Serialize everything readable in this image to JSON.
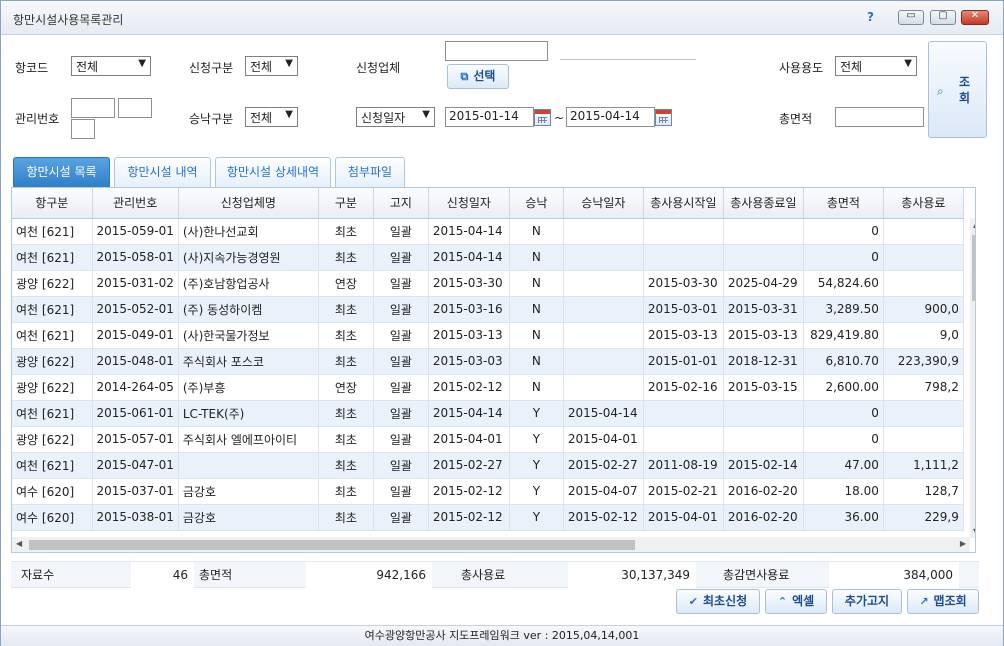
{
  "window": {
    "title": "항만시설사용목록관리",
    "help": "?",
    "min": "▭",
    "max": "▢",
    "close": "✕"
  },
  "filters": {
    "port_code": {
      "label": "항코드",
      "value": "전체"
    },
    "apply_type": {
      "label": "신청구분",
      "value": "전체"
    },
    "applicant": {
      "label": "신청업체",
      "value": "",
      "select_label": "선택"
    },
    "usage": {
      "label": "사용용도",
      "value": "전체"
    },
    "mgmt_no": {
      "label": "관리번호",
      "v1": "",
      "v2": "",
      "v3": ""
    },
    "approve_type": {
      "label": "승낙구분",
      "value": "전체"
    },
    "date_type": {
      "value": "신청일자"
    },
    "date_from": "2015-01-14",
    "date_sep": "~",
    "date_to": "2015-04-14",
    "total_area": {
      "label": "총면적",
      "value": ""
    },
    "search_label": "조회"
  },
  "tabs": [
    {
      "label": "항만시설 목록",
      "active": true
    },
    {
      "label": "항만시설 내역",
      "active": false
    },
    {
      "label": "항만시설 상세내역",
      "active": false
    },
    {
      "label": "첨부파일",
      "active": false
    }
  ],
  "table": {
    "headers": [
      "항구분",
      "관리번호",
      "신청업체명",
      "구분",
      "고지",
      "신청일자",
      "승낙",
      "승낙일자",
      "총사용시작일",
      "총사용종료일",
      "총면적",
      "총사용료"
    ],
    "rows": [
      [
        "여천 [621]",
        "2015-059-01",
        "(사)한나선교회",
        "최초",
        "일괄",
        "2015-04-14",
        "N",
        "",
        "",
        "",
        "0",
        ""
      ],
      [
        "여천 [621]",
        "2015-058-01",
        "(사)지속가능경영원",
        "최초",
        "일괄",
        "2015-04-14",
        "N",
        "",
        "",
        "",
        "0",
        ""
      ],
      [
        "광양 [622]",
        "2015-031-02",
        "(주)호남항업공사",
        "연장",
        "일괄",
        "2015-03-30",
        "N",
        "",
        "2015-03-30",
        "2025-04-29",
        "54,824.60",
        ""
      ],
      [
        "여천 [621]",
        "2015-052-01",
        "(주) 동성하이켐",
        "최초",
        "일괄",
        "2015-03-16",
        "N",
        "",
        "2015-03-01",
        "2015-03-31",
        "3,289.50",
        "900,0"
      ],
      [
        "여천 [621]",
        "2015-049-01",
        "(사)한국물가정보",
        "최초",
        "일괄",
        "2015-03-13",
        "N",
        "",
        "2015-03-13",
        "2015-03-13",
        "829,419.80",
        "9,0"
      ],
      [
        "광양 [622]",
        "2015-048-01",
        "주식회사 포스코",
        "최초",
        "일괄",
        "2015-03-03",
        "N",
        "",
        "2015-01-01",
        "2018-12-31",
        "6,810.70",
        "223,390,9"
      ],
      [
        "광양 [622]",
        "2014-264-05",
        "(주)부흥",
        "연장",
        "일괄",
        "2015-02-12",
        "N",
        "",
        "2015-02-16",
        "2015-03-15",
        "2,600.00",
        "798,2"
      ],
      [
        "여천 [621]",
        "2015-061-01",
        "LC-TEK(주)",
        "최초",
        "일괄",
        "2015-04-14",
        "Y",
        "2015-04-14",
        "",
        "",
        "0",
        ""
      ],
      [
        "광양 [622]",
        "2015-057-01",
        "주식회사 엘에프아이티",
        "최초",
        "일괄",
        "2015-04-01",
        "Y",
        "2015-04-01",
        "",
        "",
        "0",
        ""
      ],
      [
        "여천 [621]",
        "2015-047-01",
        "",
        "최초",
        "일괄",
        "2015-02-27",
        "Y",
        "2015-02-27",
        "2011-08-19",
        "2015-02-14",
        "47.00",
        "1,111,2"
      ],
      [
        "여수 [620]",
        "2015-037-01",
        "금강호",
        "최초",
        "일괄",
        "2015-02-12",
        "Y",
        "2015-04-07",
        "2015-02-21",
        "2016-02-20",
        "18.00",
        "128,7"
      ],
      [
        "여수 [620]",
        "2015-038-01",
        "금강호",
        "최초",
        "일괄",
        "2015-02-12",
        "Y",
        "2015-02-12",
        "2015-04-01",
        "2016-02-20",
        "36.00",
        "229,9"
      ]
    ]
  },
  "summary": {
    "count_label": "자료수",
    "count": "46",
    "area_label": "총면적",
    "area": "942,166",
    "fee_label": "총사용료",
    "fee": "30,137,349",
    "reduced_label": "총감면사용료",
    "reduced": "384,000"
  },
  "actions": {
    "first_apply": "최초신청",
    "excel": "엑셀",
    "add_notice": "추가고지",
    "map_search": "맵조회"
  },
  "status": "여수광양항만공사 지도프레임워크 ver : 2015,04,14,001",
  "colors": {
    "accent": "#2f7fc8",
    "row_alt": "#e9f2fb",
    "button_text": "#1d4e8b"
  }
}
